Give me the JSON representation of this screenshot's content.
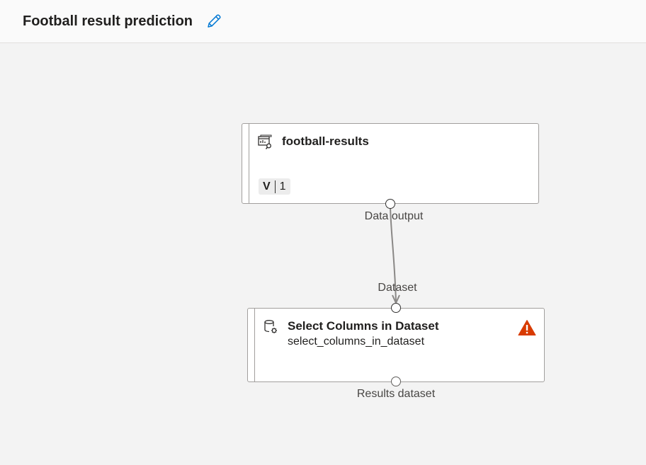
{
  "header": {
    "title": "Football result prediction"
  },
  "nodes": {
    "dataset": {
      "title": "football-results",
      "version_prefix": "V",
      "version": "1",
      "output_port_label": "Data output"
    },
    "select_columns": {
      "title": "Select Columns in Dataset",
      "subtitle": "select_columns_in_dataset",
      "input_port_label": "Dataset",
      "output_port_label": "Results dataset",
      "status": "warning"
    }
  },
  "colors": {
    "canvas": "#f3f3f3",
    "header": "#fafafa",
    "accent": "#0078d4",
    "warning": "#d83b01",
    "connector": "#8a8886"
  }
}
